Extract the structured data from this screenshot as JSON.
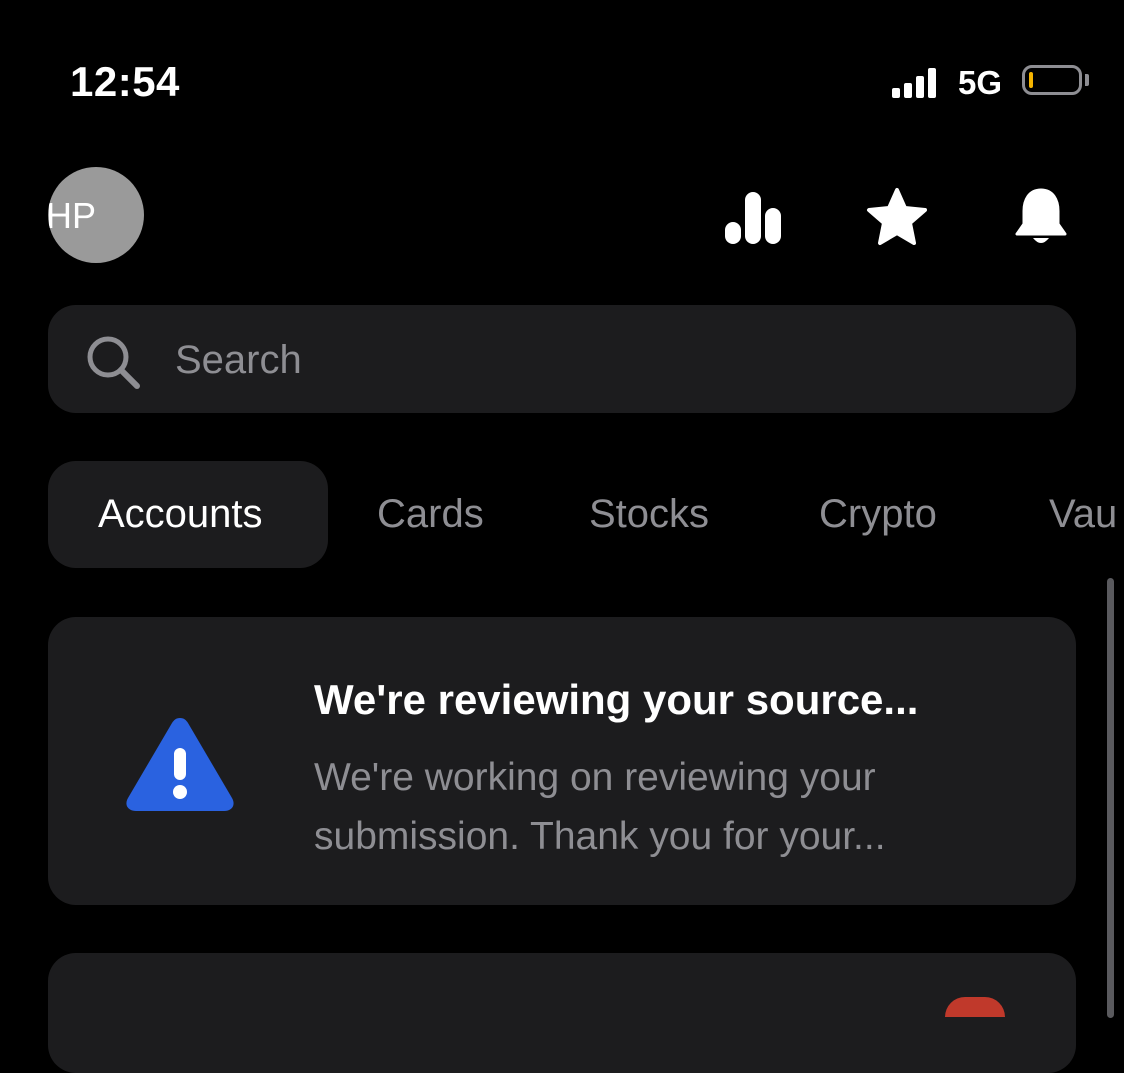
{
  "status_bar": {
    "time": "12:54",
    "network": "5G",
    "signal_icon": "cellular-signal-icon",
    "battery_icon": "battery-low-icon",
    "battery_color": "#f5b400"
  },
  "header": {
    "avatar_initials": "HP",
    "icons": [
      "bar-chart-icon",
      "star-icon",
      "bell-icon"
    ]
  },
  "search": {
    "placeholder": "Search",
    "value": ""
  },
  "tabs": [
    {
      "label": "Accounts",
      "active": true
    },
    {
      "label": "Cards",
      "active": false
    },
    {
      "label": "Stocks",
      "active": false
    },
    {
      "label": "Crypto",
      "active": false
    },
    {
      "label": "Vau",
      "active": false
    }
  ],
  "notice": {
    "icon": "warning-triangle-icon",
    "icon_color": "#2a62e0",
    "title": "We're reviewing your source...",
    "description": "We're working on reviewing your submission. Thank you for your..."
  },
  "colors": {
    "background": "#000000",
    "surface": "#1c1c1e",
    "muted_text": "#8e8e93"
  }
}
